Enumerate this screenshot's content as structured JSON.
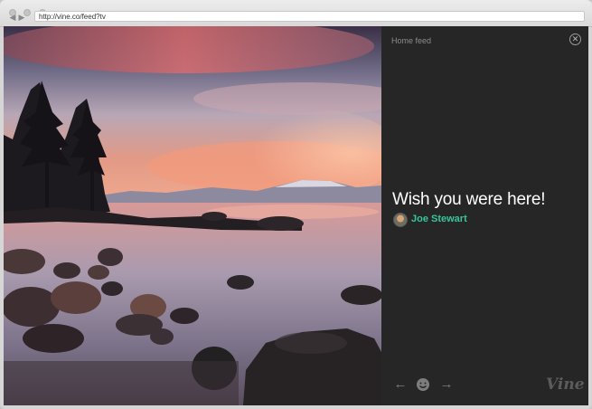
{
  "browser": {
    "url": "http://vine.co/feed?tv",
    "back_icon": "back-arrow-icon",
    "forward_icon": "forward-arrow-icon"
  },
  "photo": {
    "description_icon": "sunset-lake-image"
  },
  "panel": {
    "feed_label": "Home feed",
    "caption": "Wish you were here!",
    "author_name": "Joe Stewart",
    "brand": "Vine",
    "colors": {
      "background": "#262626",
      "author": "#35c59c"
    }
  }
}
